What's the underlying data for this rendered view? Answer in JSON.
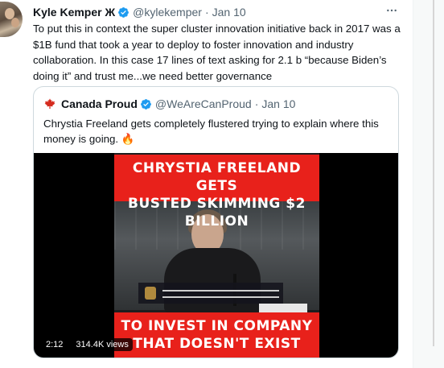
{
  "tweet": {
    "author_name": "Kyle Kemper Ж",
    "author_handle": "@kylekemper",
    "separator": "·",
    "date": "Jan 10",
    "more_icon": "more-horizontal-icon",
    "text": "To put this in context the super cluster innovation initiative back in 2017 was a $1B fund that took a year to deploy to foster innovation and industry collaboration. In this case 17 lines of text asking for 2.1 b “because Biden’s doing it” and trust me...we need better governance"
  },
  "quote": {
    "author_name": "Canada Proud",
    "author_handle": "@WeAreCanProud",
    "separator": "·",
    "date": "Jan 10",
    "text": "Chrystia Freeland gets completely flustered trying to explain where this money is going. 🔥",
    "video": {
      "banner_top_line1": "CHRYSTIA FREELAND GETS",
      "banner_top_line2": "BUSTED SKIMMING $2 BILLION",
      "banner_bottom_line1": "TO INVEST IN COMPANY",
      "banner_bottom_line2": "THAT DOESN'T EXIST",
      "duration": "2:12",
      "views": "314.4K views"
    }
  },
  "colors": {
    "verified_blue": "#1d9bf0",
    "banner_red": "#e8211b",
    "maple_red": "#d52b1e",
    "secondary_text": "#536471"
  }
}
